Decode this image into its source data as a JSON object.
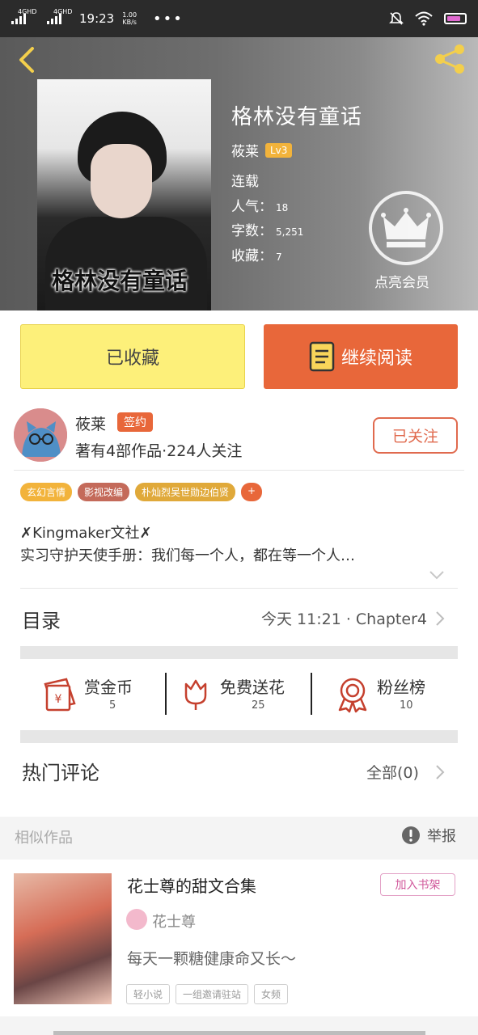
{
  "status_bar": {
    "network_1": "4GHD",
    "network_2": "4GHD",
    "time": "19:23",
    "speed_value": "1.00",
    "speed_unit": "KB/s",
    "menu_dots": "•••"
  },
  "book": {
    "cover_title": "格林没有童话",
    "title": "格林没有童话",
    "author": "莜莱",
    "level": "Lv3",
    "status": "连载",
    "popularity_label": "人气：",
    "popularity_value": "18",
    "word_count_label": "字数：",
    "word_count_value": "5,251",
    "favorites_label": "收藏：",
    "favorites_value": "7",
    "vip_label": "点亮会员"
  },
  "actions": {
    "favorited_label": "已收藏",
    "continue_label": "继续阅读"
  },
  "author_card": {
    "name": "莜莱",
    "sign_badge": "签约",
    "stats": "著有4部作品·224人关注",
    "follow_label": "已关注"
  },
  "tags": [
    {
      "label": "玄幻言情",
      "color": "#f2b33b"
    },
    {
      "label": "影视改编",
      "color": "#c46a5a"
    },
    {
      "label": "朴灿烈吴世勋边伯贤",
      "color": "#e0a93a"
    },
    {
      "label": "+",
      "color": "#e8673a"
    }
  ],
  "intro": {
    "line1": "✗Kingmaker文社✗",
    "line2": "实习守护天使手册：我们每一个人，都在等一个人…"
  },
  "catalog": {
    "label": "目录",
    "update": "今天 11:21 · Chapter4"
  },
  "rewards": [
    {
      "label": "赏金币",
      "count": "5"
    },
    {
      "label": "免费送花",
      "count": "25"
    },
    {
      "label": "粉丝榜",
      "count": "10"
    }
  ],
  "comments": {
    "label": "热门评论",
    "all_label": "全部(0)"
  },
  "similar": {
    "label": "相似作品",
    "report_label": "举报",
    "item": {
      "title": "花士尊的甜文合集",
      "add_shelf_label": "加入书架",
      "author": "花士尊",
      "description": "每天一颗糖健康命又长～",
      "tags": [
        "轻小说",
        "一组邀请驻站",
        "女频"
      ]
    }
  },
  "colors": {
    "accent_orange": "#e8673a",
    "favorite_yellow": "#fdf07a",
    "level_badge": "#f2b33b",
    "shelf_pink": "#d0569a"
  },
  "icons": [
    "back-arrow-icon",
    "share-icon",
    "crown-icon",
    "book-icon",
    "red-envelope-icon",
    "flower-icon",
    "medal-icon",
    "chevron-right-icon",
    "chevron-down-icon",
    "report-exclamation-icon",
    "wifi-icon",
    "mute-bell-icon",
    "battery-icon"
  ]
}
